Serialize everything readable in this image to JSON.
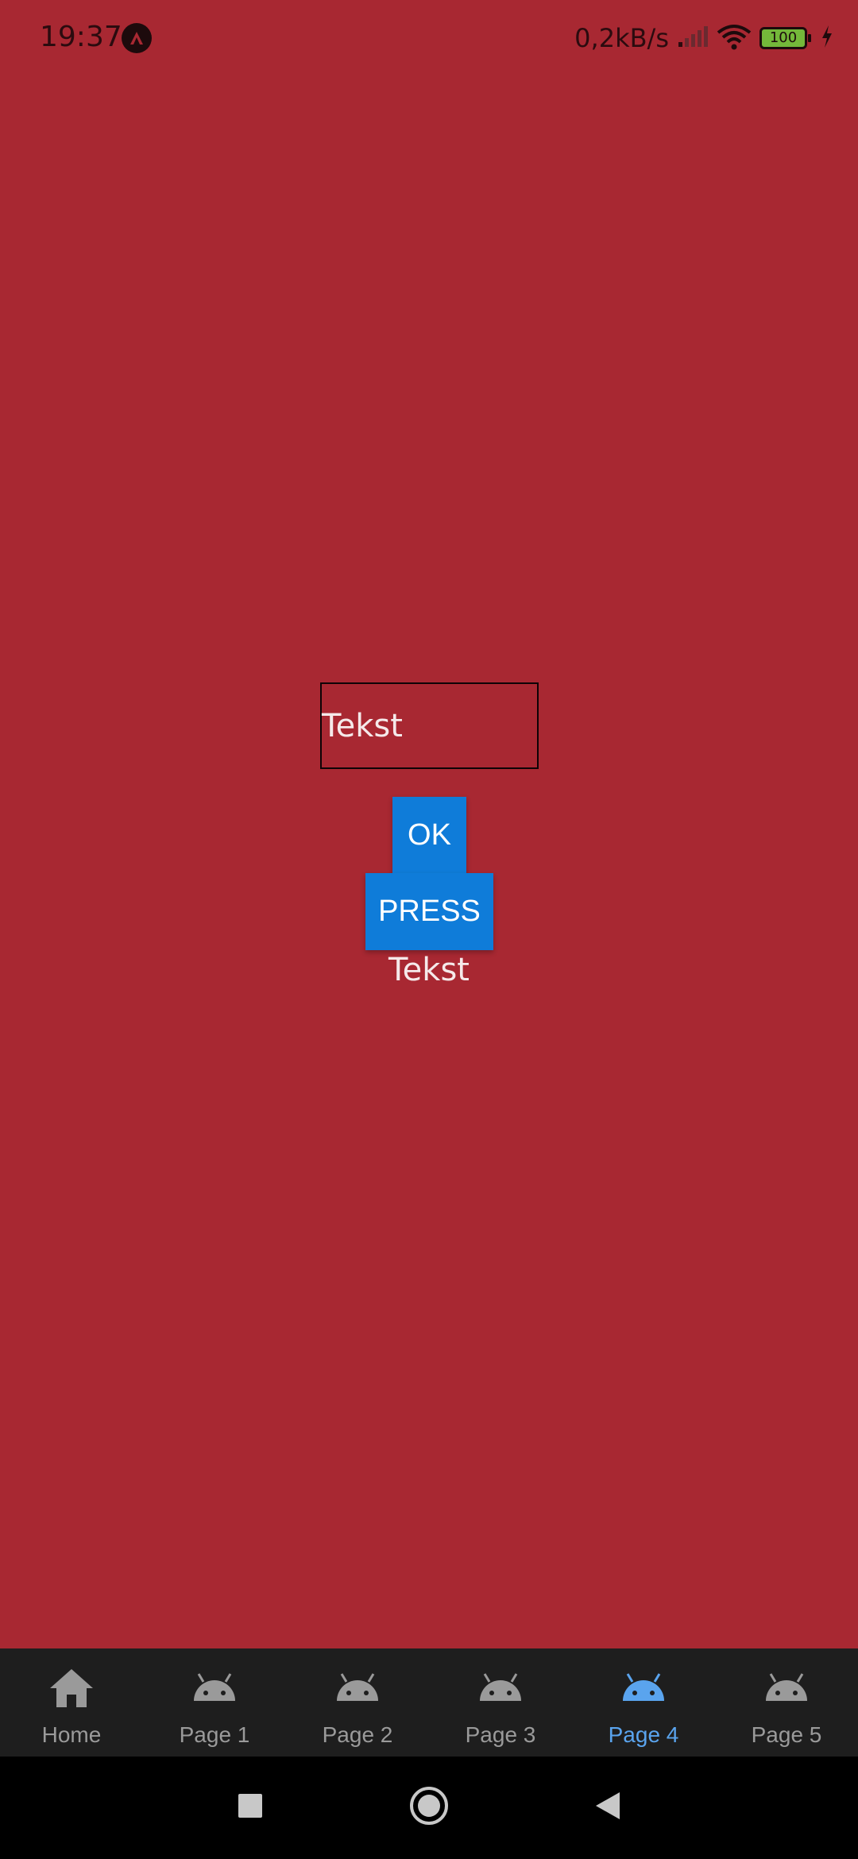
{
  "status_bar": {
    "time": "19:37",
    "net_speed": "0,2kB/s",
    "battery_level": "100",
    "icons": [
      "app-notification-icon",
      "signal-icon",
      "wifi-icon",
      "battery-icon",
      "charging-icon"
    ]
  },
  "main": {
    "text_field_value": "Tekst",
    "ok_button_label": "OK",
    "press_button_label": "PRESS",
    "text_label": "Tekst"
  },
  "tab_bar": {
    "active_index": 4,
    "tabs": [
      {
        "label": "Home",
        "icon": "home-icon"
      },
      {
        "label": "Page 1",
        "icon": "android-icon"
      },
      {
        "label": "Page 2",
        "icon": "android-icon"
      },
      {
        "label": "Page 3",
        "icon": "android-icon"
      },
      {
        "label": "Page 4",
        "icon": "android-icon"
      },
      {
        "label": "Page 5",
        "icon": "android-icon"
      }
    ]
  },
  "nav_bar": {
    "buttons": [
      "recents-button",
      "home-button",
      "back-button"
    ]
  },
  "colors": {
    "background": "#a82832",
    "button": "#0f7cd9",
    "tab_bar": "#1e1e1e",
    "tab_active": "#5aa4ee",
    "tab_inactive": "#9a9a9a"
  }
}
